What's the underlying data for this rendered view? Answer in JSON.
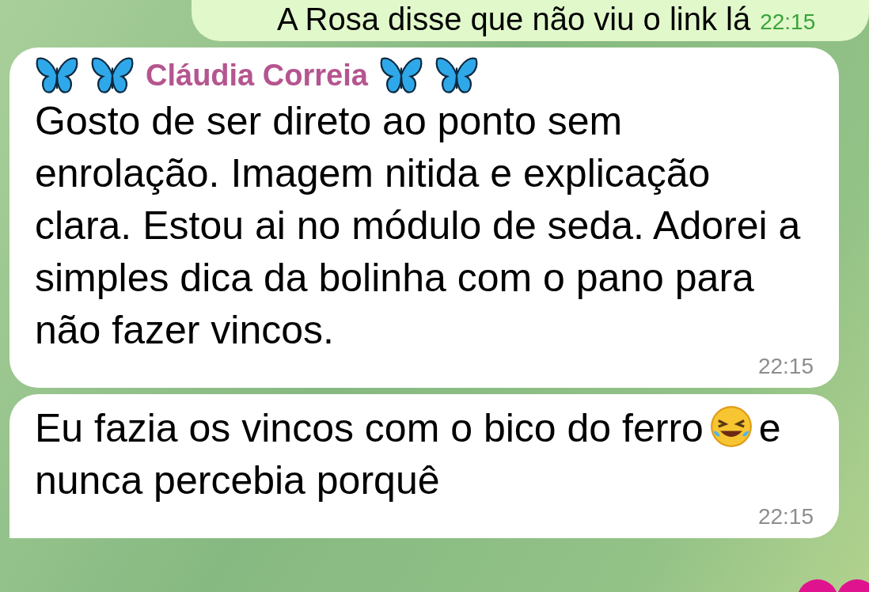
{
  "messages": [
    {
      "kind": "outgoing",
      "text_parts": [
        "A Rosa disse que não viu o link lá"
      ],
      "time": "22:15"
    },
    {
      "kind": "incoming",
      "sender": "Cláudia Correia",
      "text_parts": [
        "Gosto de ser direto ao ponto sem enrolação. Imagem nitida e explicação clara. Estou ai no módulo de seda. Adorei a simples dica da bolinha com o pano para não fazer vincos."
      ],
      "time": "22:15"
    },
    {
      "kind": "incoming",
      "text_parts": [
        "Eu fazia os vincos com o bico do ferro",
        "e nunca percebia porquê"
      ],
      "time": "22:15",
      "tail": true
    }
  ]
}
